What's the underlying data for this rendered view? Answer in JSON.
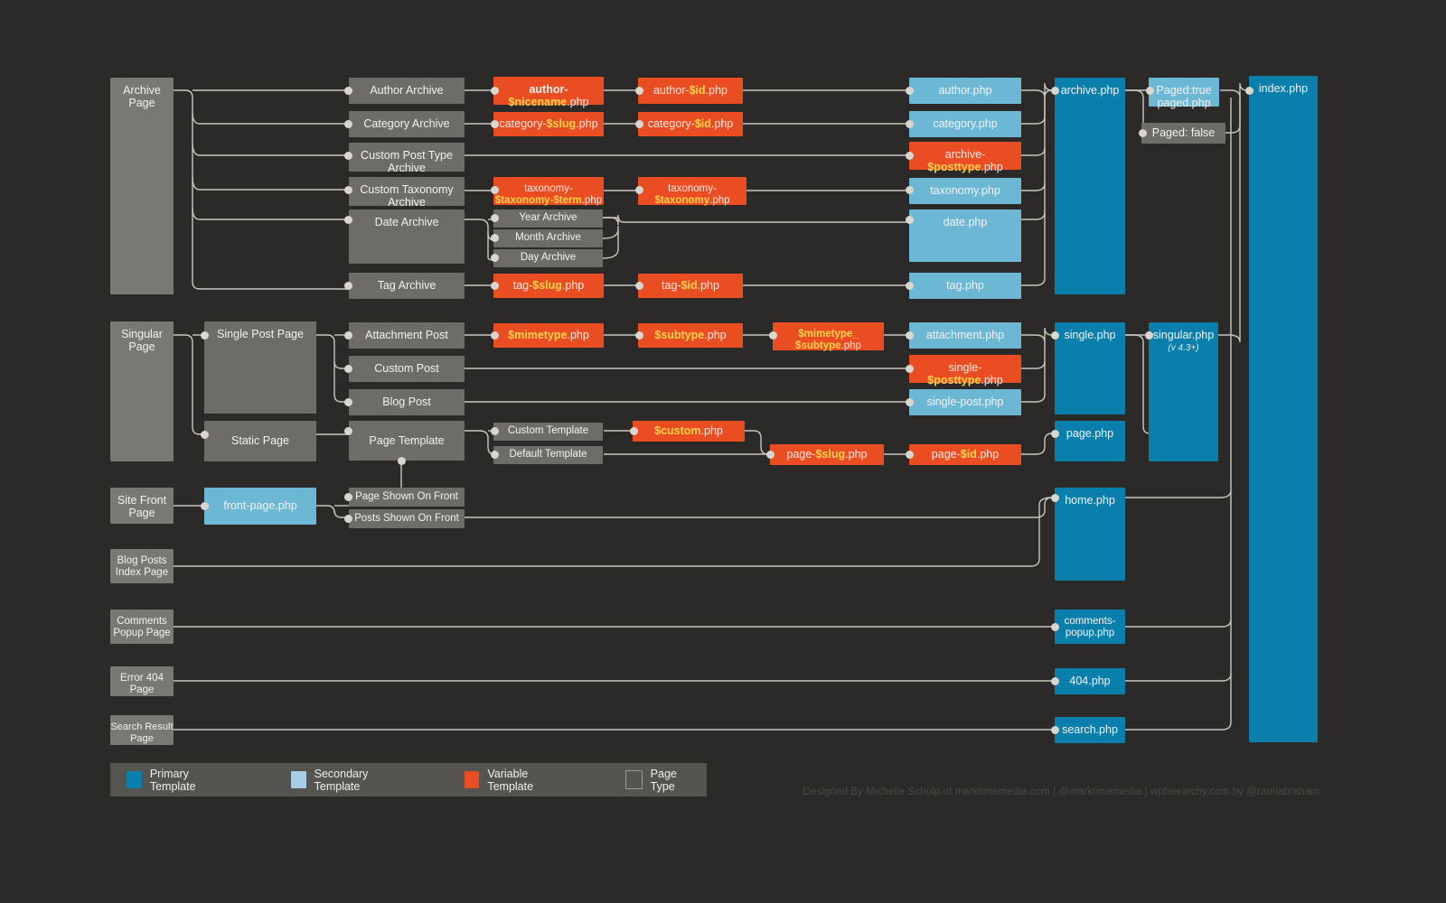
{
  "diagram": {
    "title": "WordPress Template Hierarchy",
    "background_color": "#2b2a28"
  },
  "colors": {
    "primary_template": "#0b7fab",
    "secondary_template": "#6cb8d4",
    "variable_template": "#ea4d22",
    "page_type": "#7a7873",
    "variable_token": "#ffd34d",
    "wire": "#c9c6c0"
  },
  "nodes": {
    "archive_page": {
      "label": "Archive\nPage",
      "type": "page"
    },
    "author_archive": {
      "label": "Author Archive",
      "type": "page"
    },
    "category_archive": {
      "label": "Category Archive",
      "type": "page"
    },
    "custom_post_type_archive": {
      "label": "Custom Post Type\nArchive",
      "type": "page"
    },
    "custom_taxonomy_archive": {
      "label": "Custom Taxonomy\nArchive",
      "type": "page"
    },
    "date_archive": {
      "label": "Date Archive",
      "type": "page"
    },
    "year_archive": {
      "label": "Year Archive",
      "type": "page"
    },
    "month_archive": {
      "label": "Month Archive",
      "type": "page"
    },
    "day_archive": {
      "label": "Day Archive",
      "type": "page"
    },
    "tag_archive": {
      "label": "Tag Archive",
      "type": "page"
    },
    "author_nicename_php": {
      "label": "author-$nicename.php",
      "type": "variable"
    },
    "author_id_php": {
      "label": "author-$id.php",
      "type": "variable"
    },
    "category_slug_php": {
      "label": "category-$slug.php",
      "type": "variable"
    },
    "category_id_php": {
      "label": "category-$id.php",
      "type": "variable"
    },
    "taxonomy_term_php": {
      "label": "taxonomy-$taxonomy-$term.php",
      "type": "variable"
    },
    "taxonomy_taxonomy_php": {
      "label": "taxonomy-$taxonomy.php",
      "type": "variable"
    },
    "tag_slug_php": {
      "label": "tag-$slug.php",
      "type": "variable"
    },
    "tag_id_php": {
      "label": "tag-$id.php",
      "type": "variable"
    },
    "author_php": {
      "label": "author.php",
      "type": "secondary"
    },
    "category_php": {
      "label": "category.php",
      "type": "secondary"
    },
    "archive_posttype_php": {
      "label": "archive-$posttype.php",
      "type": "variable"
    },
    "taxonomy_php": {
      "label": "taxonomy.php",
      "type": "secondary"
    },
    "date_php": {
      "label": "date.php",
      "type": "secondary"
    },
    "tag_php": {
      "label": "tag.php",
      "type": "secondary"
    },
    "archive_php": {
      "label": "archive.php",
      "type": "primary"
    },
    "paged_true": {
      "label": "Paged:true\npaged.php",
      "type": "secondary"
    },
    "paged_false": {
      "label": "Paged: false",
      "type": "page"
    },
    "index_php": {
      "label": "index.php",
      "type": "primary"
    },
    "singular_page": {
      "label": "Singular\nPage",
      "type": "page"
    },
    "single_post_page": {
      "label": "Single Post Page",
      "type": "page"
    },
    "static_page": {
      "label": "Static Page",
      "type": "page"
    },
    "attachment_post": {
      "label": "Attachment Post",
      "type": "page"
    },
    "custom_post": {
      "label": "Custom Post",
      "type": "page"
    },
    "blog_post": {
      "label": "Blog Post",
      "type": "page"
    },
    "page_template": {
      "label": "Page Template",
      "type": "page"
    },
    "custom_template": {
      "label": "Custom Template",
      "type": "page"
    },
    "default_template": {
      "label": "Default Template",
      "type": "page"
    },
    "mimetype_php": {
      "label": "$mimetype.php",
      "type": "variable"
    },
    "subtype_php": {
      "label": "$subtype.php",
      "type": "variable"
    },
    "mimetype_subtype_php": {
      "label": "$mimetype_$subtype.php",
      "type": "variable"
    },
    "attachment_php": {
      "label": "attachment.php",
      "type": "secondary"
    },
    "single_posttype_php": {
      "label": "single-$posttype.php",
      "type": "variable"
    },
    "single_post_php": {
      "label": "single-post.php",
      "type": "secondary"
    },
    "custom_php": {
      "label": "$custom.php",
      "type": "variable"
    },
    "page_slug_php": {
      "label": "page-$slug.php",
      "type": "variable"
    },
    "page_id_php": {
      "label": "page-$id.php",
      "type": "variable"
    },
    "single_php": {
      "label": "single.php",
      "type": "primary"
    },
    "page_php": {
      "label": "page.php",
      "type": "primary"
    },
    "singular_php": {
      "label": "singular.php",
      "version": "(v 4.3+)",
      "type": "primary"
    },
    "site_front_page": {
      "label": "Site Front\nPage",
      "type": "page"
    },
    "front_page_php": {
      "label": "front-page.php",
      "type": "secondary"
    },
    "page_shown_on_front": {
      "label": "Page Shown On Front",
      "type": "page"
    },
    "posts_shown_on_front": {
      "label": "Posts Shown On Front",
      "type": "page"
    },
    "blog_posts_index_page": {
      "label": "Blog Posts\nIndex Page",
      "type": "page"
    },
    "home_php": {
      "label": "home.php",
      "type": "primary"
    },
    "comments_popup_page": {
      "label": "Comments\nPopup Page",
      "type": "page"
    },
    "comments_popup_php": {
      "label": "comments-popup.php",
      "type": "primary"
    },
    "error_404_page": {
      "label": "Error 404\nPage",
      "type": "page"
    },
    "error_404_php": {
      "label": "404.php",
      "type": "primary"
    },
    "search_result_page": {
      "label": "Search Result\nPage",
      "type": "page"
    },
    "search_php": {
      "label": "search.php",
      "type": "primary"
    }
  },
  "legend": {
    "items": [
      {
        "label": "Primary Template",
        "color": "#0b7fab"
      },
      {
        "label": "Secondary Template",
        "color": "#6cb8d4"
      },
      {
        "label": "Variable Template",
        "color": "#ea4d22"
      },
      {
        "label": "Page Type",
        "color": "#565451"
      }
    ]
  },
  "credits": {
    "text": "Designed By Michelle Schulp of marktimemedia.com  |  @marktimemedia  | wphierarchy.com by @ramiabraham"
  }
}
